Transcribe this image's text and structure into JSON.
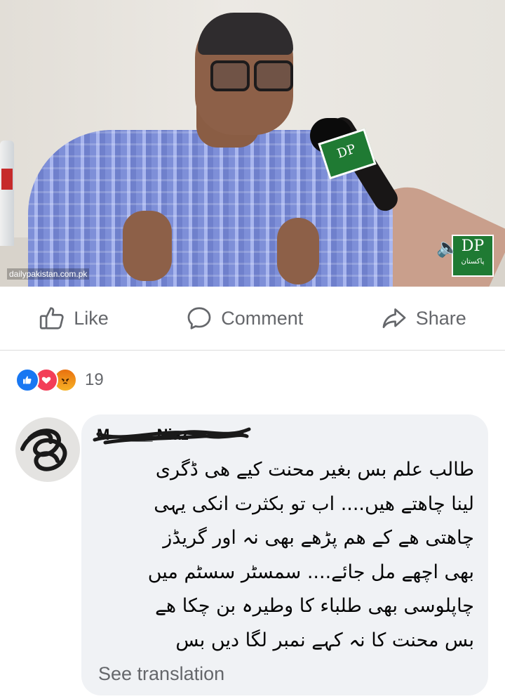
{
  "video": {
    "watermark": "dailypakistan.com.pk",
    "logo_big": "DP",
    "logo_small": "پاکستان",
    "mic_flag": "DP"
  },
  "actions": {
    "like_label": "Like",
    "comment_label": "Comment",
    "share_label": "Share"
  },
  "reactions": {
    "types": [
      "like",
      "love",
      "angry"
    ],
    "count": "19"
  },
  "comment": {
    "author_name": "M_____ Niaz",
    "lines": [
      "طالب علم بس بغیر محنت کیے ھی ڈگری",
      "لینا چاھتے ھیں.... اب تو بکثرت انکی یہی",
      "چاھتی ھے کے ھم پڑھے بھی نہ اور گریڈز",
      "بھی اچھے مل جائے.... سمسٹر سسٹم میں",
      "چاپلوسی بھی طلباء کا وطیرہ بن چکا ھے",
      "بس محنت کا نہ کہے نمبر لگا دیں بس"
    ],
    "see_translation": "See translation"
  },
  "colors": {
    "facebook_blue": "#1877f2",
    "love_red": "#f33e58",
    "angry_orange": "#e9710f",
    "secondary_text": "#65676b",
    "bubble_bg": "#f0f2f5"
  }
}
